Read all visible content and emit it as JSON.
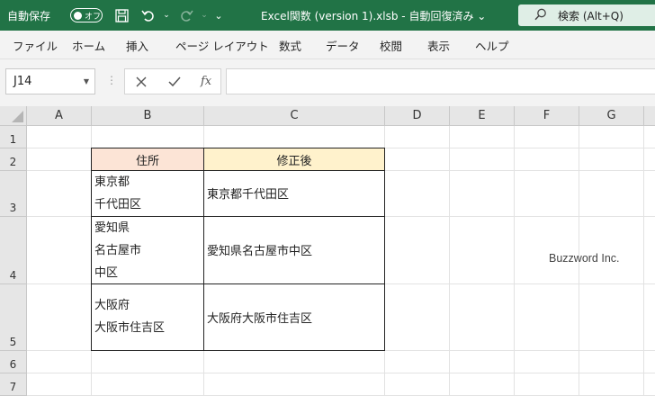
{
  "titlebar": {
    "autosave_label": "自動保存",
    "autosave_state": "オフ",
    "file_title": "Excel関数 (version 1).xlsb  -  自動回復済み  ⌄",
    "search_label": "検索 (Alt+Q)",
    "accent_color": "#217346"
  },
  "ribbon": {
    "tabs": [
      "ファイル",
      "ホーム",
      "挿入",
      "ページ レイアウト",
      "数式",
      "データ",
      "校閲",
      "表示",
      "ヘルプ"
    ]
  },
  "formula_bar": {
    "name_box": "J14",
    "formula": ""
  },
  "sheet": {
    "columns": [
      "A",
      "B",
      "C",
      "D",
      "E",
      "F",
      "G"
    ],
    "rows": [
      "1",
      "2",
      "3",
      "4",
      "5",
      "6",
      "7"
    ],
    "cells": {
      "B2": "住所",
      "C2": "修正後",
      "B3": [
        "東京都",
        "千代田区"
      ],
      "C3": "東京都千代田区",
      "B4": [
        "愛知県",
        "名古屋市",
        "中区"
      ],
      "C4": "愛知県名古屋市中区",
      "B5": [
        "大阪府",
        "大阪市住吉区"
      ],
      "C5": "大阪府大阪市住吉区"
    },
    "header_fill_b": "#fce4d6",
    "header_fill_c": "#fff2cc"
  },
  "watermark": "Buzzword Inc."
}
